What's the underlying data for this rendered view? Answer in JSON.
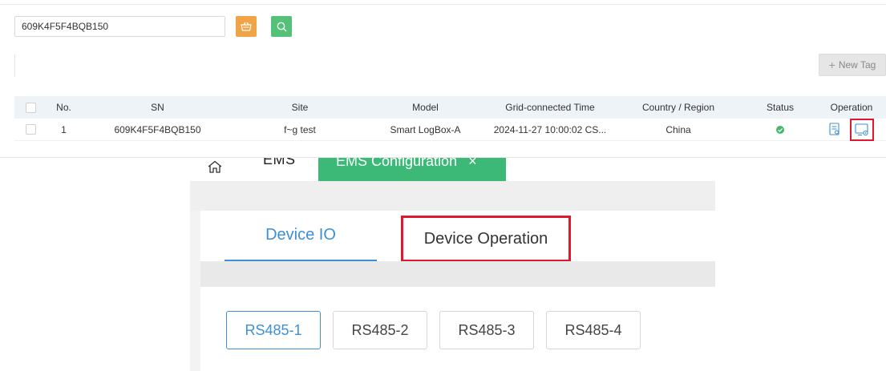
{
  "search": {
    "value": "609K4F5F4BQB150"
  },
  "toolbar": {
    "new_tag_label": "New Tag"
  },
  "table": {
    "headers": [
      "No.",
      "SN",
      "Site",
      "Model",
      "Grid-connected Time",
      "Country / Region",
      "Status",
      "Operation"
    ],
    "rows": [
      {
        "no": "1",
        "sn": "609K4F5F4BQB150",
        "site": "f~g test",
        "model": "Smart LogBox-A",
        "time": "2024-11-27 10:00:02 CS...",
        "country": "China",
        "status": "online"
      }
    ]
  },
  "ems_tabs": {
    "home_label": "",
    "ems_label": "EMS",
    "config_label": "EMS Configuration",
    "config_close": "×"
  },
  "sub_tabs": {
    "io_label": "Device IO",
    "operation_label": "Device Operation"
  },
  "ports": [
    "RS485-1",
    "RS485-2",
    "RS485-3",
    "RS485-4"
  ],
  "colors": {
    "accent_blue": "#3d8fd8",
    "green": "#3cb877",
    "orange": "#f0a445",
    "highlight_red": "#e0182d"
  }
}
